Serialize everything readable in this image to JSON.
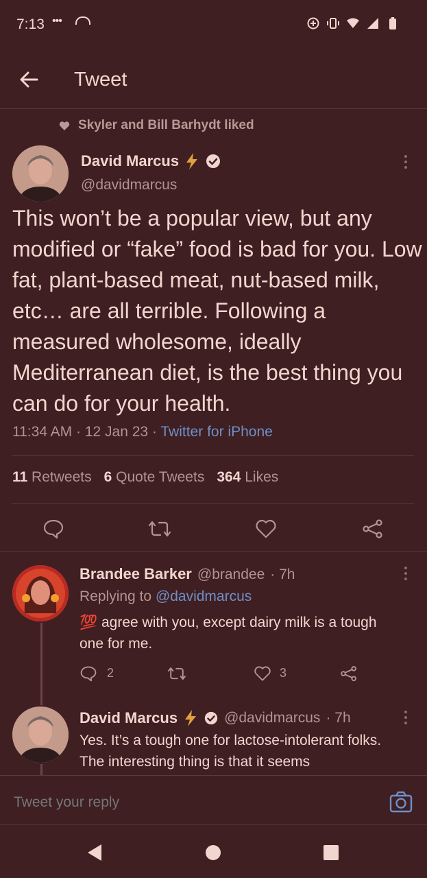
{
  "status": {
    "time": "7:13",
    "dots": "•••"
  },
  "header": {
    "title": "Tweet"
  },
  "social_context": "Skyler and Bill Barhydt liked",
  "tweet": {
    "author_name": "David Marcus",
    "author_handle": "@davidmarcus",
    "text": "This won’t be a popular view, but any modified or “fake” food is bad for you. Low fat, plant-based meat, nut-based milk, etc… are all terrible. Following a measured wholesome, ideally Mediterranean diet, is the best thing you can do for your health.",
    "time": "11:34 AM",
    "date": "12 Jan 23",
    "source": "Twitter for iPhone",
    "retweets_count": "11",
    "retweets_label": "Retweets",
    "quotes_count": "6",
    "quotes_label": "Quote Tweets",
    "likes_count": "364",
    "likes_label": "Likes"
  },
  "replies": [
    {
      "name": "Brandee Barker",
      "handle": "@brandee",
      "age": "· 7h",
      "replying_prefix": "Replying to",
      "replying_to": "@davidmarcus",
      "emoji": "💯",
      "text": "agree with you, except dairy milk is a tough one for me.",
      "reply_count": "2",
      "like_count": "3"
    },
    {
      "name": "David Marcus",
      "handle": "@davidmarcus",
      "age": "· 7h",
      "text": "Yes. It’s a tough one for lactose-intolerant folks. The interesting thing is that it seems"
    }
  ],
  "reply_bar": {
    "placeholder": "Tweet your reply"
  },
  "colors": {
    "background": "#3f1f22",
    "text": "#f0d6cf",
    "muted": "#b39491",
    "link": "#6f8fc8",
    "bolt": "#e0a040"
  }
}
